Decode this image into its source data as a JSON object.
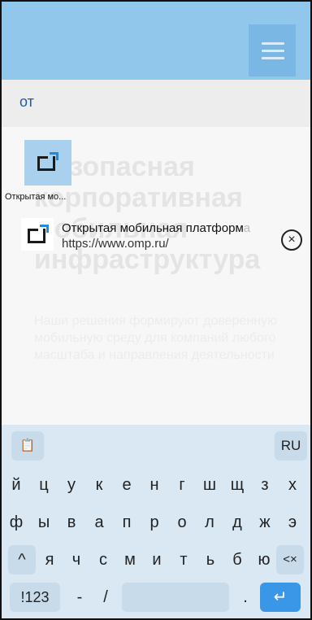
{
  "search": {
    "text": "от"
  },
  "background_page": {
    "headline": "Безопасная корпоративная мобильная инфраструктура",
    "body": "Наши решения формируют доверенную мобильную среду для компаний любого масштаба и направления деятельности"
  },
  "shortcut": {
    "label": "Открытая мо..."
  },
  "suggestion": {
    "title_match": "От",
    "title_rest": "крытая мобильная платформ",
    "title_fade": "а",
    "url": "https://www.omp.ru/",
    "close_glyph": "×"
  },
  "keyboard": {
    "clipboard_glyph": "📋",
    "lang": "RU",
    "row1": [
      "й",
      "ц",
      "у",
      "к",
      "е",
      "н",
      "г",
      "ш",
      "щ",
      "з",
      "х"
    ],
    "row2": [
      "ф",
      "ы",
      "в",
      "а",
      "п",
      "р",
      "о",
      "л",
      "д",
      "ж",
      "э"
    ],
    "row3": [
      "я",
      "ч",
      "с",
      "м",
      "и",
      "т",
      "ь",
      "б",
      "ю"
    ],
    "shift_glyph": "^",
    "backspace_glyph": "<×",
    "sym_label": "!123",
    "dash": "-",
    "slash": "/",
    "dot": ".",
    "enter_glyph": "↵"
  },
  "colors": {
    "topbar": "#92c7ec",
    "accent": "#3a97e7",
    "search_text": "#1f5aa6",
    "keyboard_bg": "#dae8f3"
  }
}
